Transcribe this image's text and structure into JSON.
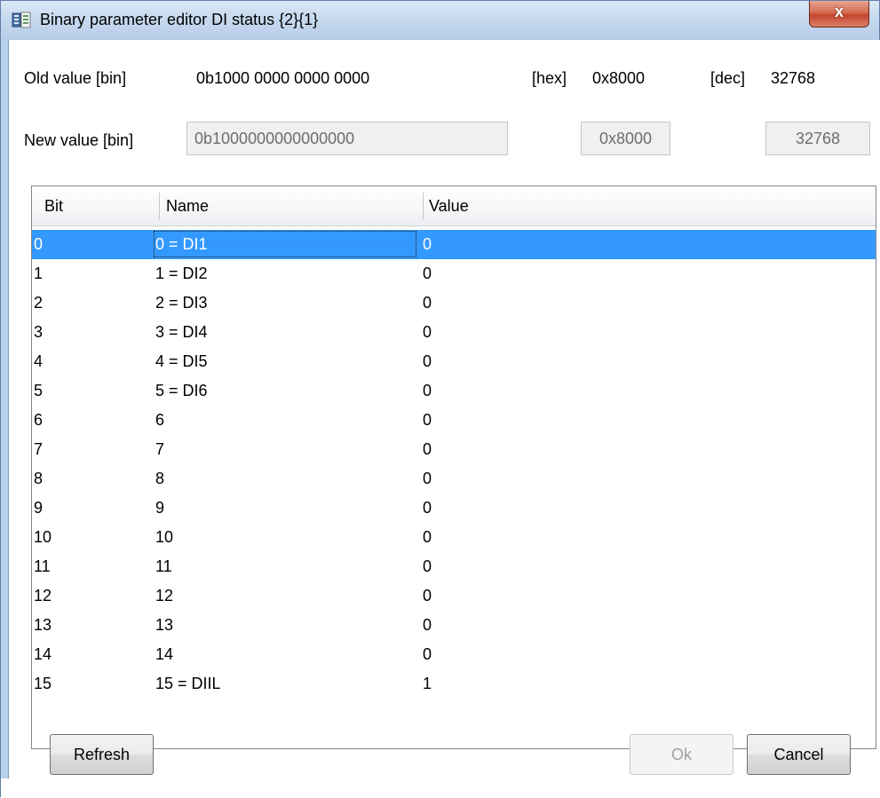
{
  "window": {
    "title": "Binary parameter editor DI status {2}{1}",
    "close_glyph": "x"
  },
  "old_value": {
    "bin_label": "Old value [bin]",
    "bin_value": "0b1000 0000 0000 0000",
    "hex_label": "[hex]",
    "hex_value": "0x8000",
    "dec_label": "[dec]",
    "dec_value": "32768"
  },
  "new_value": {
    "bin_label": "New value [bin]",
    "bin_value": "0b1000000000000000",
    "hex_value": "0x8000",
    "dec_value": "32768"
  },
  "table": {
    "columns": [
      "Bit",
      "Name",
      "Value"
    ],
    "rows": [
      {
        "bit": "0",
        "name": "0 = DI1",
        "value": "0",
        "selected": true
      },
      {
        "bit": "1",
        "name": "1 = DI2",
        "value": "0"
      },
      {
        "bit": "2",
        "name": "2 = DI3",
        "value": "0"
      },
      {
        "bit": "3",
        "name": "3 = DI4",
        "value": "0"
      },
      {
        "bit": "4",
        "name": "4 = DI5",
        "value": "0"
      },
      {
        "bit": "5",
        "name": "5 = DI6",
        "value": "0"
      },
      {
        "bit": "6",
        "name": "6",
        "value": "0"
      },
      {
        "bit": "7",
        "name": "7",
        "value": "0"
      },
      {
        "bit": "8",
        "name": "8",
        "value": "0"
      },
      {
        "bit": "9",
        "name": "9",
        "value": "0"
      },
      {
        "bit": "10",
        "name": "10",
        "value": "0"
      },
      {
        "bit": "11",
        "name": "11",
        "value": "0"
      },
      {
        "bit": "12",
        "name": "12",
        "value": "0"
      },
      {
        "bit": "13",
        "name": "13",
        "value": "0"
      },
      {
        "bit": "14",
        "name": "14",
        "value": "0"
      },
      {
        "bit": "15",
        "name": "15 = DIIL",
        "value": "1"
      }
    ]
  },
  "buttons": {
    "refresh": "Refresh",
    "ok": "Ok",
    "cancel": "Cancel"
  },
  "colors": {
    "selection": "#3399ff",
    "titlebar": "#c5d8ee",
    "close": "#c4452b"
  },
  "icons": {
    "app": "binary-editor-icon",
    "close": "close-icon"
  }
}
